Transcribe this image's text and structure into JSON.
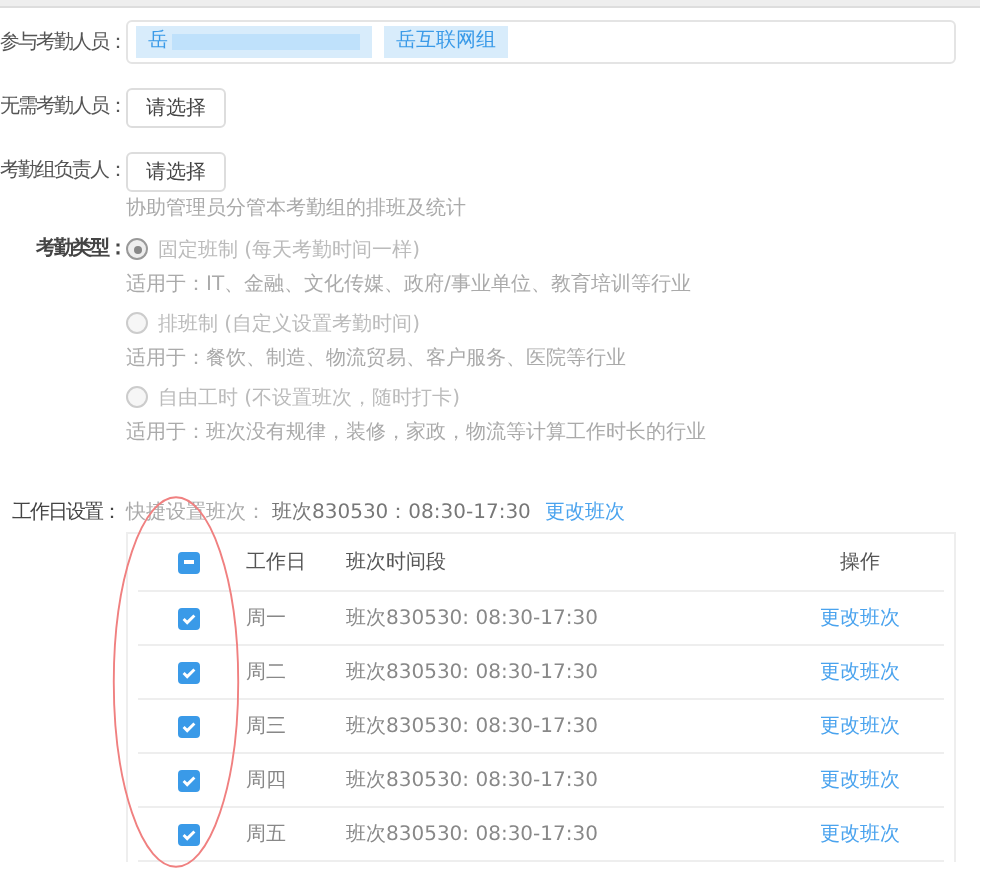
{
  "fields": [
    {
      "kind": "tags",
      "label": "参与考勤人员：",
      "tags": [
        {
          "text": "岳",
          "redacted": true
        },
        {
          "text": "岳互联网组",
          "redacted": false
        }
      ]
    },
    {
      "kind": "button",
      "label": "无需考勤人员：",
      "button": "请选择"
    },
    {
      "kind": "button",
      "label": "考勤组负责人：",
      "button": "请选择",
      "hint": "协助管理员分管本考勤组的排班及统计"
    },
    {
      "kind": "radios",
      "label": "考勤类型：",
      "options": [
        {
          "text": "固定班制 (每天考勤时间一样)",
          "desc": "适用于：IT、金融、文化传媒、政府/事业单位、教育培训等行业",
          "selected": true
        },
        {
          "text": "排班制 (自定义设置考勤时间)",
          "desc": "适用于：餐饮、制造、物流贸易、客户服务、医院等行业",
          "selected": false
        },
        {
          "text": "自由工时 (不设置班次，随时打卡)",
          "desc": "适用于：班次没有规律，装修，家政，物流等计算工作时长的行业",
          "selected": false
        }
      ]
    }
  ],
  "workdays": {
    "label": "工作日设置：",
    "quick": "快捷设置班次：",
    "shift": "班次830530：08:30-17:30",
    "change": "更改班次",
    "table": {
      "columns": [
        "工作日",
        "班次时间段",
        "操作"
      ],
      "indeterminate": true,
      "rows": [
        {
          "day": "周一",
          "shift": "班次830530: 08:30-17:30",
          "action": "更改班次",
          "checked": true
        },
        {
          "day": "周二",
          "shift": "班次830530: 08:30-17:30",
          "action": "更改班次",
          "checked": true
        },
        {
          "day": "周三",
          "shift": "班次830530: 08:30-17:30",
          "action": "更改班次",
          "checked": true
        },
        {
          "day": "周四",
          "shift": "班次830530: 08:30-17:30",
          "action": "更改班次",
          "checked": true
        },
        {
          "day": "周五",
          "shift": "班次830530: 08:30-17:30",
          "action": "更改班次",
          "checked": true
        }
      ]
    }
  }
}
